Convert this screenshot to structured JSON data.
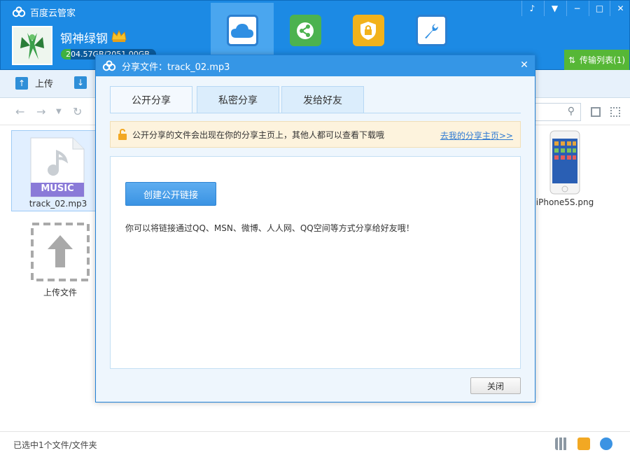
{
  "app": {
    "title": "百度云管家"
  },
  "user": {
    "name": "钢神绿钢",
    "quota": "204.57GB/2051.00GB",
    "quota_used_fraction": 0.1
  },
  "nav": {
    "tabs": [
      {
        "name": "cloud-tab",
        "icon": "cloud-icon"
      },
      {
        "name": "share-tab",
        "icon": "share-icon"
      },
      {
        "name": "safe-tab",
        "icon": "lock-icon"
      },
      {
        "name": "tools-tab",
        "icon": "wrench-icon"
      }
    ]
  },
  "window_controls": [
    "bell-icon",
    "menu-icon",
    "minimize-icon",
    "maximize-icon",
    "close-icon"
  ],
  "transfer": {
    "label": "传输列表(1)"
  },
  "toolbar": {
    "upload": "上传"
  },
  "files": [
    {
      "name": "track_02.mp3",
      "badge": "MUSIC"
    },
    {
      "name": "上传文件"
    },
    {
      "name": "iPhone5S.png"
    }
  ],
  "status": {
    "text": "已选中1个文件/文件夹"
  },
  "dialog": {
    "title": "分享文件：track_02.mp3",
    "tabs": [
      "公开分享",
      "私密分享",
      "发给好友"
    ],
    "notice": "公开分享的文件会出现在你的分享主页上，其他人都可以查看下载哦",
    "notice_link": "去我的分享主页>>",
    "create_button": "创建公开链接",
    "hint": "你可以将链接通过QQ、MSN、微博、人人网、QQ空间等方式分享给好友哦！",
    "close_button": "关闭"
  },
  "colors": {
    "header": "#1c8ae4",
    "transfer": "#56b736",
    "link": "#2f7bd3"
  }
}
